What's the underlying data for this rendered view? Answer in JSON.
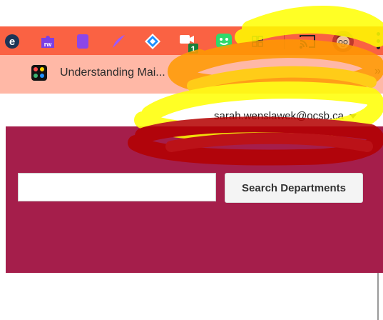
{
  "toolbar": {
    "extensions": [
      {
        "icon": "browser-e-icon"
      },
      {
        "icon": "read-write-icon",
        "label": "rw"
      },
      {
        "icon": "purple-doc-icon"
      },
      {
        "icon": "feather-icon"
      },
      {
        "icon": "blue-diamond-icon"
      },
      {
        "icon": "meet-badge-icon",
        "badge": "1"
      },
      {
        "icon": "bitmoji-icon"
      },
      {
        "icon": "apps-grid-icon"
      },
      {
        "icon": "cast-icon"
      },
      {
        "icon": "profile-avatar-icon"
      }
    ],
    "colors": {
      "bar": "#fa6243",
      "bookmarks_bar": "#ffb8a6"
    }
  },
  "bookmarks": {
    "item_label": "Understanding Mai...",
    "overflow_label": "»"
  },
  "account": {
    "email": "sarah.wenslawek@ocsb.ca"
  },
  "search": {
    "placeholder": "",
    "value": "",
    "button_label": "Search Departments"
  },
  "colors": {
    "banner": "#a51e4b",
    "highlighter_yellow": "#ffff00",
    "highlighter_orange": "#ff8800",
    "highlighter_red": "#b40000"
  }
}
